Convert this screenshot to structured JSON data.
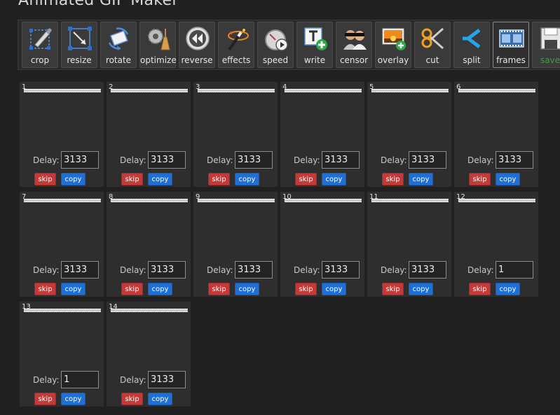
{
  "app": {
    "title": "Animated GIF Maker"
  },
  "toolbar": {
    "tools": [
      {
        "label": "crop",
        "icon": "crop-icon"
      },
      {
        "label": "resize",
        "icon": "resize-icon"
      },
      {
        "label": "rotate",
        "icon": "rotate-icon"
      },
      {
        "label": "optimize",
        "icon": "optimize-icon"
      },
      {
        "label": "reverse",
        "icon": "reverse-icon"
      },
      {
        "label": "effects",
        "icon": "effects-icon"
      },
      {
        "label": "speed",
        "icon": "speed-icon"
      },
      {
        "label": "write",
        "icon": "write-icon"
      },
      {
        "label": "censor",
        "icon": "censor-icon"
      },
      {
        "label": "overlay",
        "icon": "overlay-icon"
      },
      {
        "label": "cut",
        "icon": "cut-icon"
      },
      {
        "label": "split",
        "icon": "split-icon"
      },
      {
        "label": "frames",
        "icon": "frames-icon",
        "active": true
      },
      {
        "label": "save",
        "icon": "save-icon"
      }
    ]
  },
  "frames": {
    "delay_label": "Delay:",
    "skip_label": "skip",
    "copy_label": "copy",
    "items": [
      {
        "number": "1",
        "delay": "3133"
      },
      {
        "number": "2",
        "delay": "3133"
      },
      {
        "number": "3",
        "delay": "3133"
      },
      {
        "number": "4",
        "delay": "3133"
      },
      {
        "number": "5",
        "delay": "3133"
      },
      {
        "number": "6",
        "delay": "3133"
      },
      {
        "number": "7",
        "delay": "3133"
      },
      {
        "number": "8",
        "delay": "3133"
      },
      {
        "number": "9",
        "delay": "3133"
      },
      {
        "number": "10",
        "delay": "3133"
      },
      {
        "number": "11",
        "delay": "3133"
      },
      {
        "number": "12",
        "delay": "1"
      },
      {
        "number": "13",
        "delay": "1"
      },
      {
        "number": "14",
        "delay": "3133"
      }
    ]
  },
  "colors": {
    "background": "#202020",
    "frame_card": "#2e2e2e",
    "skip_button": "#c33b38",
    "copy_button": "#1f6fd4",
    "save_label": "#3ca03c"
  }
}
